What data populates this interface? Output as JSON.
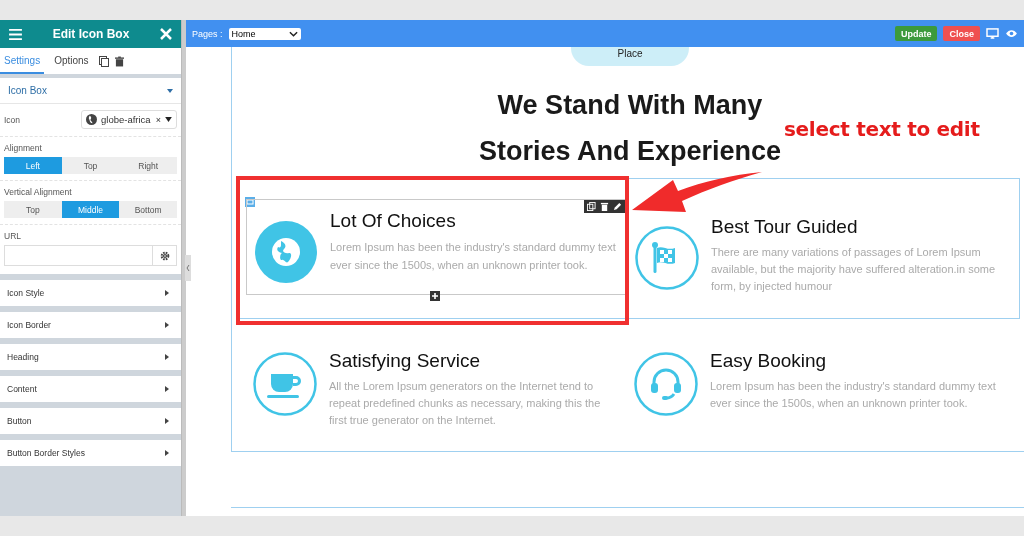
{
  "sidebar": {
    "title": "Edit Icon Box",
    "tabs": [
      {
        "label": "Settings",
        "selected": true
      },
      {
        "label": "Options",
        "selected": false
      }
    ],
    "panel": {
      "title": "Icon Box",
      "expanded": true,
      "icon_field": {
        "label": "Icon",
        "value": "globe-africa",
        "clear": "×"
      },
      "alignment": {
        "label": "Alignment",
        "options": [
          {
            "label": "Left",
            "selected": true
          },
          {
            "label": "Top",
            "selected": false
          },
          {
            "label": "Right",
            "selected": false
          }
        ]
      },
      "vertical_alignment": {
        "label": "Vertical Alignment",
        "options": [
          {
            "label": "Top",
            "selected": false
          },
          {
            "label": "Middle",
            "selected": true
          },
          {
            "label": "Bottom",
            "selected": false
          }
        ]
      },
      "url": {
        "label": "URL"
      }
    },
    "sections": [
      {
        "title": "Icon Style",
        "expanded": false
      },
      {
        "title": "Icon Border",
        "expanded": false
      },
      {
        "title": "Heading",
        "expanded": false
      },
      {
        "title": "Content",
        "expanded": false
      },
      {
        "title": "Button",
        "expanded": false
      },
      {
        "title": "Button Border Styles",
        "expanded": false
      }
    ]
  },
  "topbar": {
    "pages_label": "Pages :",
    "page": "Home",
    "buttons": [
      {
        "label": "Update",
        "kind": "primary"
      },
      {
        "label": "Close",
        "kind": "danger"
      }
    ]
  },
  "canvas": {
    "pill": "Place",
    "heading_lines": [
      "We Stand With Many",
      "Stories And Experience"
    ],
    "features": [
      {
        "title": "Lot Of Choices",
        "text": "Lorem Ipsum has been the industry's standard dummy text ever since the 1500s, when an unknown printer took.",
        "selected": true
      },
      {
        "title": "Best Tour Guided",
        "text": "There are many variations of passages of Lorem Ipsum available, but the majority have suffered alteration.in some form, by injected humour",
        "selected": false
      },
      {
        "title": "Satisfying Service",
        "text": "All the Lorem Ipsum generators on the Internet tend to repeat predefined chunks as necessary, making this the first true generator on the Internet.",
        "selected": false
      },
      {
        "title": "Easy Booking",
        "text": "Lorem Ipsum has been the industry's standard dummy text ever since the 1500s, when an unknown printer took.",
        "selected": false
      }
    ]
  },
  "annotation": {
    "text": "select text to edit"
  }
}
